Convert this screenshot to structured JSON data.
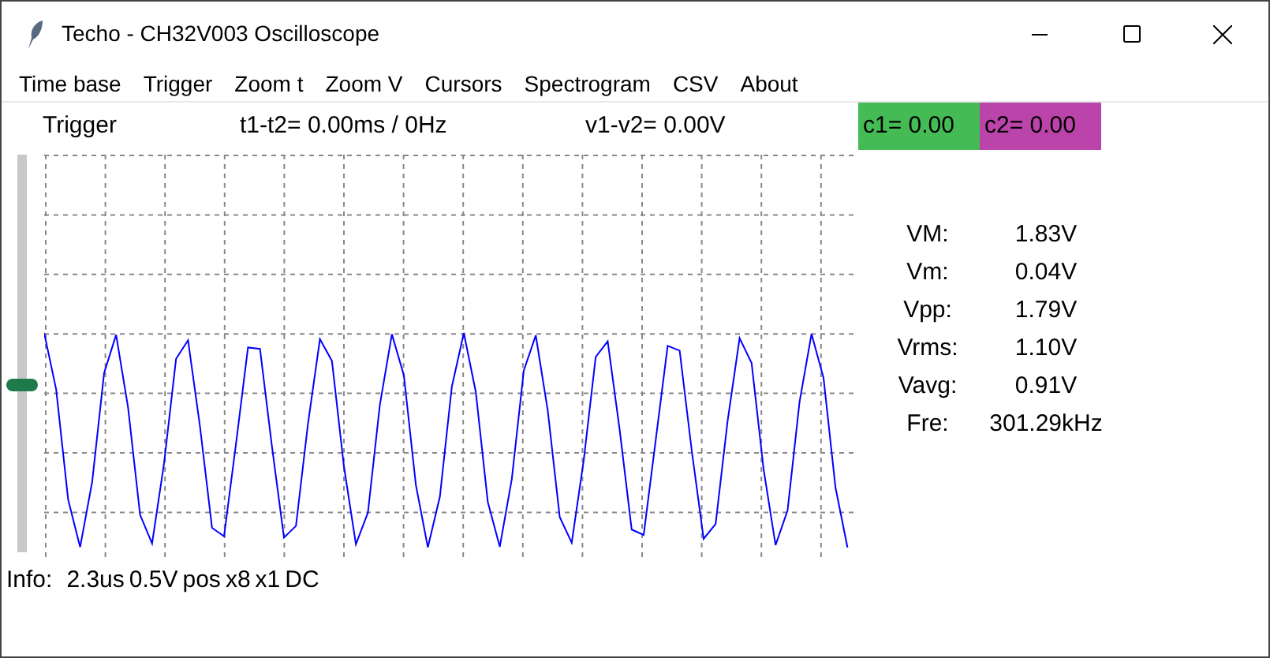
{
  "window": {
    "title": "Techo - CH32V003 Oscilloscope"
  },
  "menu": [
    "Time base",
    "Trigger",
    "Zoom t",
    "Zoom V",
    "Cursors",
    "Spectrogram",
    "CSV",
    "About"
  ],
  "header": {
    "mode": "Trigger",
    "time_delta": "t1-t2= 0.00ms / 0Hz",
    "volt_delta": "v1-v2= 0.00V",
    "cursors": [
      {
        "label": "c1= 0.00",
        "color": "#44bb55"
      },
      {
        "label": "c2= 0.00",
        "color": "#bb44aa"
      }
    ]
  },
  "trigger_slider": {
    "level": 0.42
  },
  "measurements": [
    {
      "label": "VM:",
      "value": "1.83V"
    },
    {
      "label": "Vm:",
      "value": "0.04V"
    },
    {
      "label": "Vpp:",
      "value": "1.79V"
    },
    {
      "label": "Vrms:",
      "value": "1.10V"
    },
    {
      "label": "Vavg:",
      "value": "0.91V"
    },
    {
      "label": "Fre:",
      "value": "301.29kHz"
    }
  ],
  "info": {
    "label": "Info:",
    "items": [
      "2.3us",
      "0.5V",
      "pos",
      "x8",
      "x1",
      "DC"
    ]
  }
}
